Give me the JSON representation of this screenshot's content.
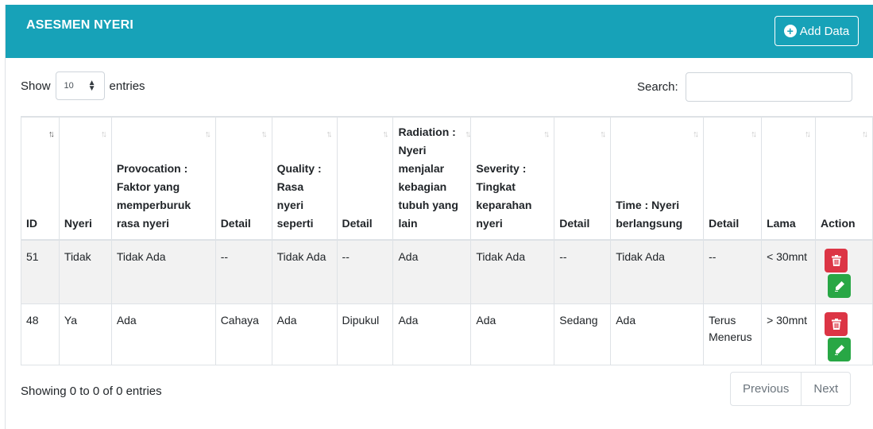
{
  "header": {
    "title": "ASESMEN NYERI",
    "add_label": "Add Data"
  },
  "length": {
    "show_label": "Show",
    "value": "10",
    "entries_label": "entries"
  },
  "search": {
    "label": "Search:",
    "value": ""
  },
  "table": {
    "columns": [
      "ID",
      "Nyeri",
      "Provocation : Faktor yang memperburuk rasa nyeri",
      "Detail",
      "Quality : Rasa nyeri seperti",
      "Detail",
      "Radiation : Nyeri menjalar kebagian tubuh yang lain",
      "Severity : Tingkat keparahan nyeri",
      "Detail",
      "Time : Nyeri berlangsung",
      "Detail",
      "Lama",
      "Action"
    ],
    "rows": [
      [
        "51",
        "Tidak",
        "Tidak Ada",
        "--",
        "Tidak Ada",
        "--",
        "Ada",
        "Tidak Ada",
        "--",
        "Tidak Ada",
        "--",
        "< 30mnt"
      ],
      [
        "48",
        "Ya",
        "Ada",
        "Cahaya",
        "Ada",
        "Dipukul",
        "Ada",
        "Ada",
        "Sedang",
        "Ada",
        "Terus Menerus",
        "> 30mnt"
      ]
    ]
  },
  "footer": {
    "info": "Showing 0 to 0 of 0 entries",
    "previous": "Previous",
    "next": "Next"
  },
  "colors": {
    "header_bg": "#17a2b8",
    "delete": "#dc3545",
    "edit": "#28a745"
  },
  "icons": {
    "add": "plus-circle-icon",
    "delete": "trash-icon",
    "edit": "pencil-icon"
  }
}
